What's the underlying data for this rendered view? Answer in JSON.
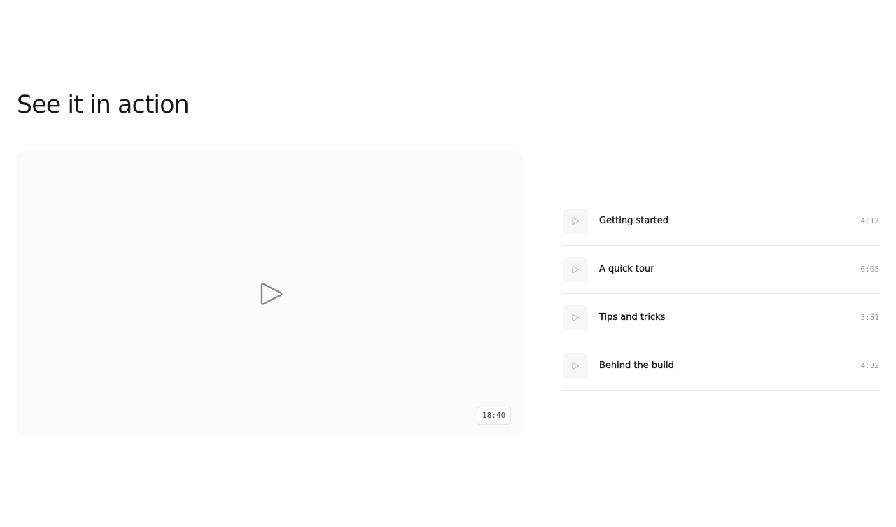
{
  "section": {
    "title": "See it in action"
  },
  "player": {
    "icon": "play-icon",
    "duration": "18:40"
  },
  "playlist": {
    "icon": "play-icon",
    "items": [
      {
        "title": "Getting started",
        "duration": "4:12"
      },
      {
        "title": "A quick tour",
        "duration": "6:05"
      },
      {
        "title": "Tips and tricks",
        "duration": "3:51"
      },
      {
        "title": "Behind the build",
        "duration": "4:32"
      }
    ]
  },
  "colors": {
    "text": "#1a1a1a",
    "muted": "#9a9a9a",
    "surface": "#fafafa",
    "border": "#e6e6e6"
  }
}
